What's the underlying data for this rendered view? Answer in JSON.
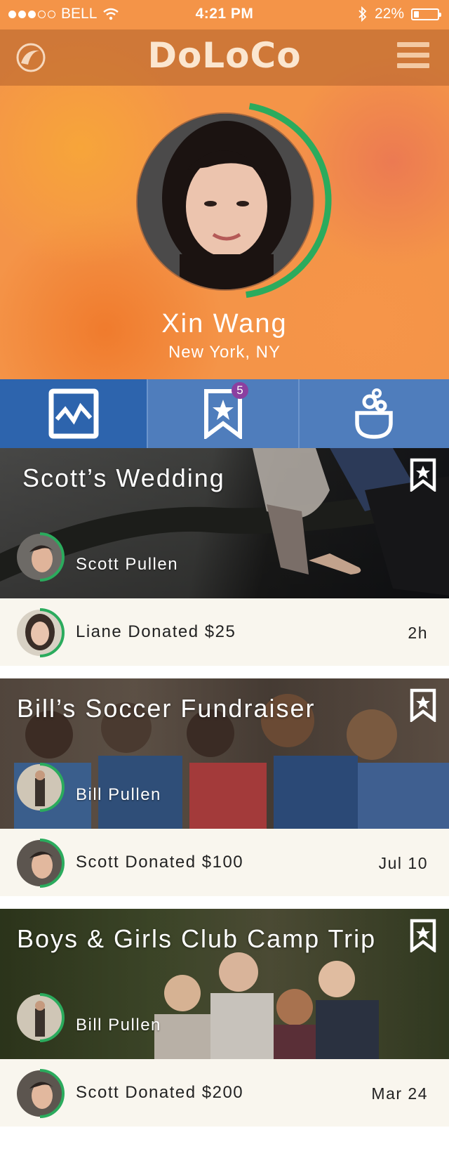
{
  "status_bar": {
    "carrier": "BELL",
    "time": "4:21 PM",
    "battery": "22%",
    "battery_level": 0.22
  },
  "app": {
    "title": "DoLoCo",
    "logo_icon": "doloco-swirl-icon",
    "menu_icon": "hamburger-menu-icon"
  },
  "profile": {
    "name": "Xin Wang",
    "location": "New York, NY",
    "ring_progress": 0.45,
    "ring_color": "#2bab5d"
  },
  "tabs": [
    {
      "icon": "activity-chart-icon",
      "active": true
    },
    {
      "icon": "bookmark-star-icon",
      "badge": "5",
      "active": false
    },
    {
      "icon": "pocket-donate-icon",
      "active": false
    }
  ],
  "campaigns": [
    {
      "title": "Scott’s Wedding",
      "owner": "Scott Pullen",
      "activity": "Liane Donated $25",
      "time": "2h"
    },
    {
      "title": "Bill’s Soccer Fundraiser",
      "owner": "Bill Pullen",
      "activity": "Scott Donated $100",
      "time": "Jul 10"
    },
    {
      "title": "Boys & Girls Club Camp Trip",
      "owner": "Bill Pullen",
      "activity": "Scott Donated $200",
      "time": "Mar 24"
    }
  ],
  "colors": {
    "hero_orange": "#f49448",
    "tab_blue": "#4f7dbc",
    "tab_active": "#2d64ad",
    "progress_green": "#2bab5d",
    "badge_purple": "#8b3fa0"
  }
}
